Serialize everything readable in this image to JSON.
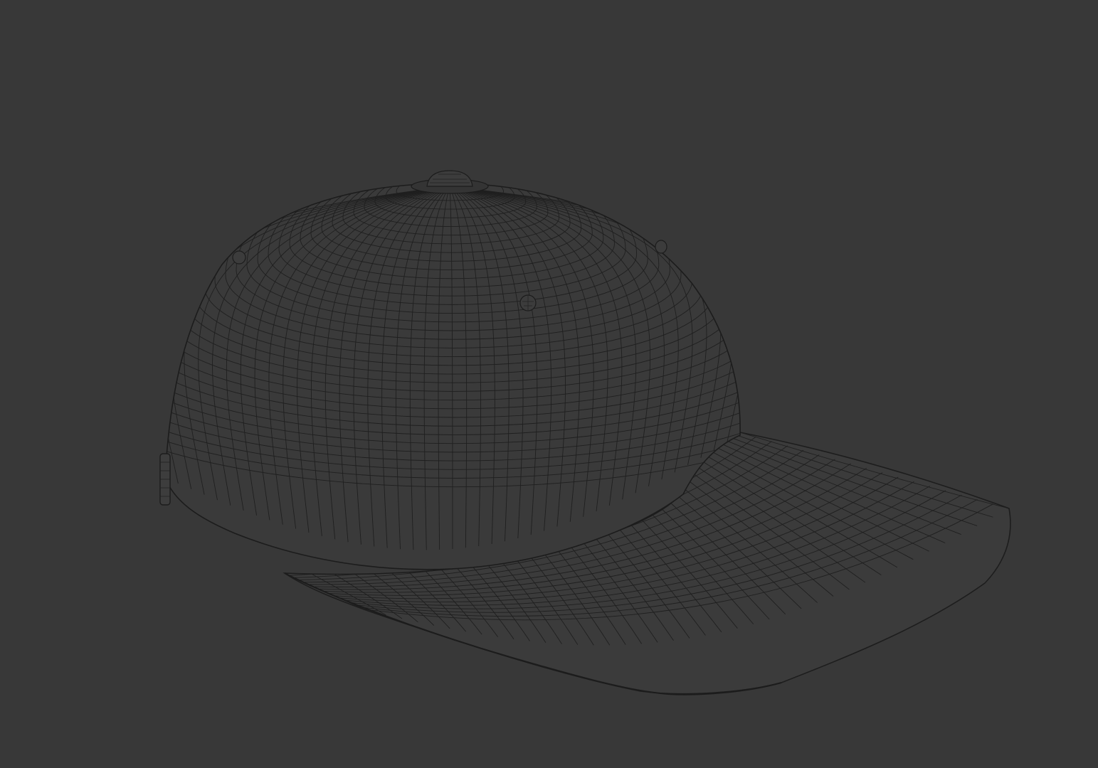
{
  "viewport": {
    "background_color": "#383838",
    "shading_mode": "wireframe-on-shaded"
  },
  "model": {
    "subject": "baseball-cap",
    "surface_color": "#3a3a3a",
    "wire_color": "#1e1e1e",
    "visible_parts": [
      "crown",
      "top-button",
      "eyelets",
      "brim",
      "side-strap-buckle"
    ]
  }
}
